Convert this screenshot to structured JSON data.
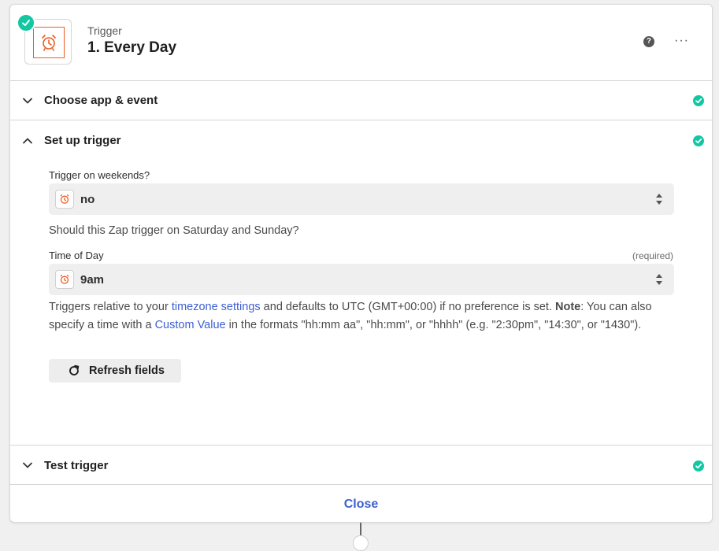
{
  "step": {
    "type_label": "Trigger",
    "title": "1. Every Day",
    "app_icon": "alarm-clock-icon",
    "status": "complete"
  },
  "header_actions": {
    "help": "?",
    "more": "···"
  },
  "sections": {
    "choose_app": {
      "title": "Choose app & event",
      "state": "collapsed",
      "complete": true
    },
    "setup": {
      "title": "Set up trigger",
      "state": "expanded",
      "complete": true
    },
    "test": {
      "title": "Test trigger",
      "state": "collapsed",
      "complete": true
    }
  },
  "fields": {
    "weekends": {
      "label": "Trigger on weekends?",
      "value": "no",
      "help": "Should this Zap trigger on Saturday and Sunday?"
    },
    "time_of_day": {
      "label": "Time of Day",
      "required_label": "(required)",
      "value": "9am",
      "help_part1": "Triggers relative to your ",
      "help_link1": "timezone settings",
      "help_part2": " and defaults to UTC (GMT+00:00) if no preference is set. ",
      "help_bold": "Note",
      "help_part3": ": You can also specify a time with a ",
      "help_link2": "Custom Value",
      "help_part4": " in the formats \"hh:mm aa\", \"hh:mm\", or \"hhhh\" (e.g. \"2:30pm\", \"14:30\", or \"1430\")."
    }
  },
  "buttons": {
    "refresh": "Refresh fields",
    "close": "Close"
  },
  "colors": {
    "accent": "#3d5fd0",
    "success": "#13c7a2",
    "app_orange": "#ec5c24"
  }
}
